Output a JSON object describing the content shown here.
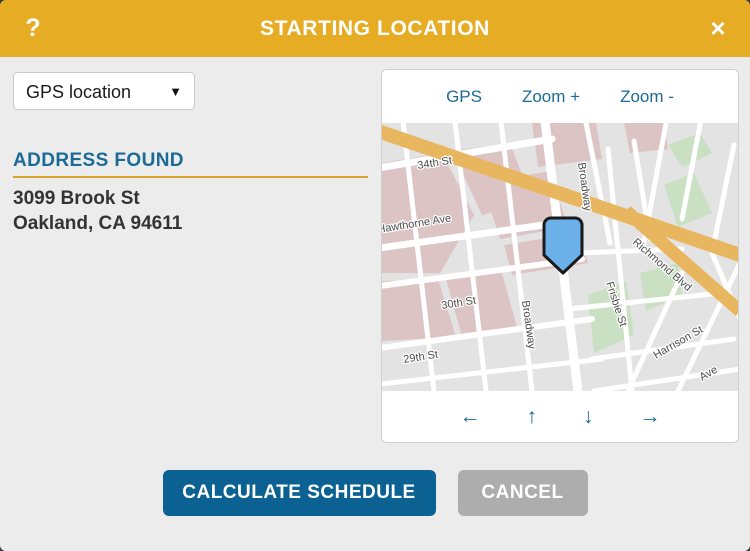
{
  "dialog": {
    "title": "STARTING LOCATION",
    "help_icon": "question-mark-icon",
    "close_icon": "close-x-icon",
    "help_label": "?",
    "close_label": "×",
    "accent_gold": "#e5ac24",
    "accent_blue": "#1b6b96",
    "body_bg": "#ececec"
  },
  "source_select": {
    "value": "GPS location",
    "arrow": "▼"
  },
  "address": {
    "heading": "ADDRESS FOUND",
    "line1": "3099 Brook St",
    "line2": "Oakland, CA 94611"
  },
  "map": {
    "toolbar": [
      {
        "label": "GPS",
        "name": "map-gps-button"
      },
      {
        "label": "Zoom +",
        "name": "map-zoom-in-button"
      },
      {
        "label": "Zoom -",
        "name": "map-zoom-out-button"
      }
    ],
    "nav": [
      {
        "label": "←",
        "name": "map-pan-left-button"
      },
      {
        "label": "↑",
        "name": "map-pan-up-button"
      },
      {
        "label": "↓",
        "name": "map-pan-down-button"
      },
      {
        "label": "→",
        "name": "map-pan-right-button"
      }
    ],
    "street_labels": [
      "34th St",
      "Hawthorne Ave",
      "30th St",
      "29th St",
      "Broadway",
      "Richmond Blvd",
      "Frisbie St",
      "Harrison St",
      "Ave"
    ],
    "marker_icon": "location-pin-marker",
    "colors": {
      "land": "#e3e3e3",
      "building": "#ddc4c4",
      "park": "#c9e0c2",
      "highway": "#e9b660",
      "road": "#ffffff",
      "marker_fill": "#6cb0ea",
      "marker_stroke": "#1a1a1a"
    }
  },
  "footer": {
    "primary_label": "CALCULATE SCHEDULE",
    "secondary_label": "CANCEL"
  }
}
